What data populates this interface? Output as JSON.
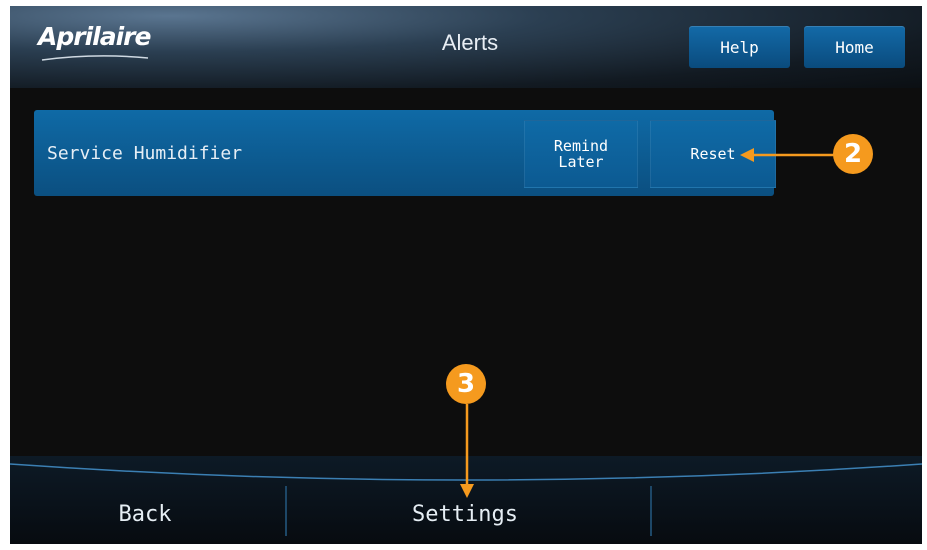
{
  "header": {
    "logo_text": "Aprilaire",
    "title": "Alerts",
    "help_label": "Help",
    "home_label": "Home"
  },
  "alerts": [
    {
      "label": "Service Humidifier",
      "remind_label": "Remind Later",
      "remind_line1": "Remind",
      "remind_line2": "Later",
      "reset_label": "Reset"
    }
  ],
  "footer": {
    "back_label": "Back",
    "settings_label": "Settings"
  },
  "annotations": {
    "badge_2": "2",
    "badge_3": "3",
    "color": "#f59a1e"
  },
  "colors": {
    "accent_blue": "#0f6aa6",
    "background": "#0d0d0d"
  }
}
